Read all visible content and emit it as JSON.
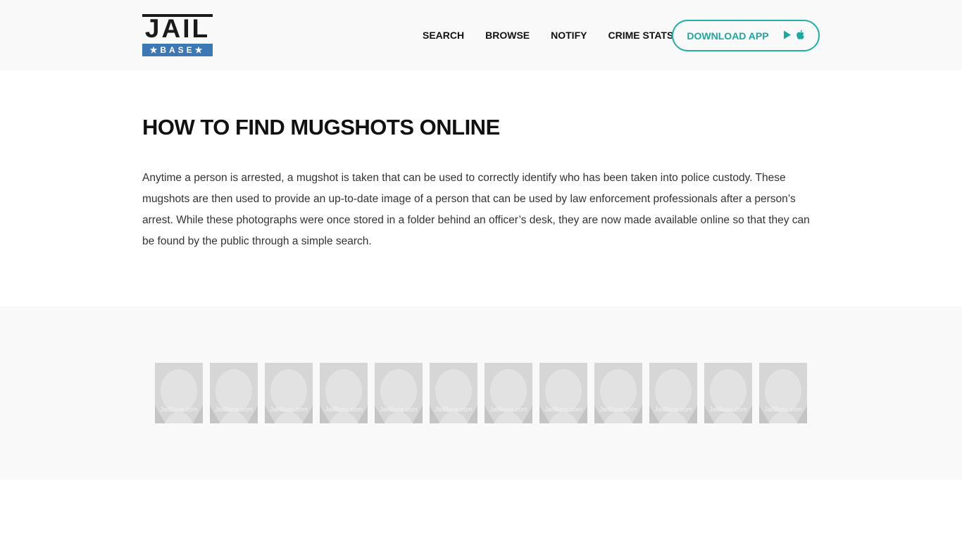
{
  "header": {
    "logo": {
      "top_text": "JAIL",
      "bottom_text": "★BASE★"
    },
    "nav": [
      "SEARCH",
      "BROWSE",
      "NOTIFY",
      "CRIME STATS"
    ],
    "download_button": {
      "label": "DOWNLOAD APP",
      "icons": [
        "play-store-icon",
        "apple-icon"
      ]
    }
  },
  "main": {
    "title": "HOW TO FIND MUGSHOTS ONLINE",
    "intro": "Anytime a person is arrested, a mugshot is taken that can be used to correctly identify who has been taken into police custody. These mugshots are then used to provide an up-to-date image of a person that can be used by law enforcement professionals after a person’s arrest. While these photographs were once stored in a folder behind an officer’s desk, they are now made available online so that they can be found by the public through a simple search."
  },
  "gallery": {
    "count": 12,
    "watermark": "JailBase.com"
  },
  "colors": {
    "accent": "#1ba99f",
    "logo_blue": "#3d78b5",
    "header_bg": "#f9f9f9"
  }
}
